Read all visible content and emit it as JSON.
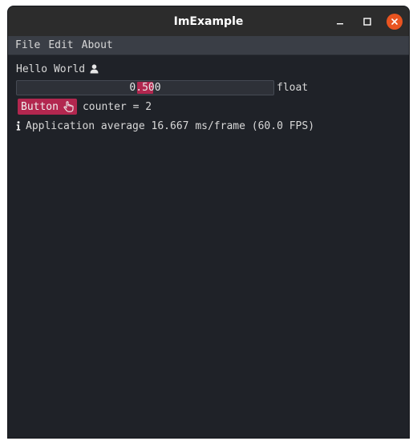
{
  "window": {
    "title": "ImExample",
    "controls": [
      "minimize-icon",
      "maximize-icon",
      "close-icon"
    ]
  },
  "menubar": {
    "items": [
      {
        "label": "File"
      },
      {
        "label": "Edit"
      },
      {
        "label": "About"
      }
    ]
  },
  "content": {
    "hello_text": "Hello World",
    "hello_icon": "user-icon",
    "slider": {
      "value": "0.500",
      "label": "float",
      "fraction": 0.5
    },
    "button": {
      "label": "Button",
      "icon": "hand-pointer-icon"
    },
    "counter_text": "counter = 2",
    "status": {
      "icon": "info-icon",
      "text": "Application average 16.667 ms/frame (60.0 FPS)"
    }
  },
  "colors": {
    "accent": "#b2274f",
    "background": "#1f2228",
    "menubar": "#3a3e46",
    "titlebar": "#2c2c2c",
    "close": "#e95420"
  }
}
